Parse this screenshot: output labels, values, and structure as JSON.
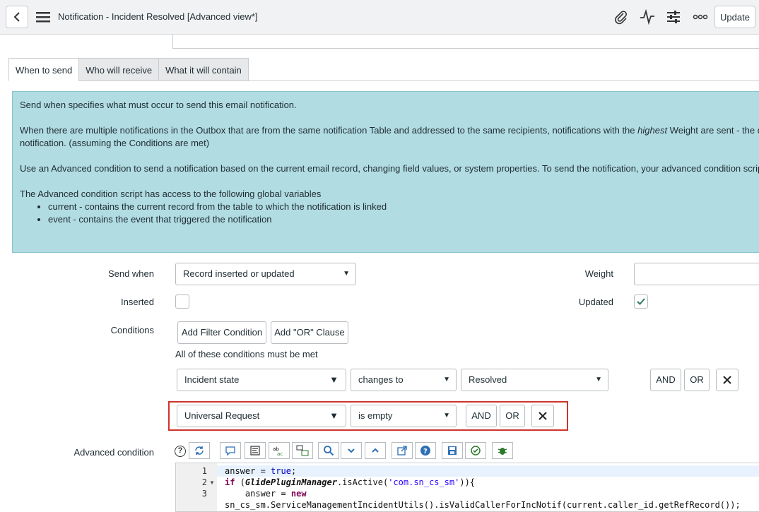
{
  "header": {
    "title": "Notification - Incident Resolved [Advanced view*]",
    "update_label": "Update"
  },
  "tabs": [
    {
      "label": "When to send",
      "active": true
    },
    {
      "label": "Who will receive",
      "active": false
    },
    {
      "label": "What it will contain",
      "active": false
    }
  ],
  "info": {
    "p1": "Send when specifies what must occur to send this email notification.",
    "p2a_pre": "When there are multiple notifications in the Outbox that are from the same notification Table and addressed to the same recipients, notifications with the ",
    "p2a_em": "highest",
    "p2a_post": " Weight are sent - the default value",
    "p2b": "notification. (assuming the Conditions are met)",
    "p3": "Use an Advanced condition to send a notification based on the current email record, changing field values, or system properties. To send the notification, your advanced condition script must set answer",
    "p4": "The Advanced condition script has access to the following global variables",
    "bullets": [
      "current - contains the current record from the table to which the notification is linked",
      "event - contains the event that triggered the notification"
    ]
  },
  "form": {
    "send_when_label": "Send when",
    "send_when_value": "Record inserted or updated",
    "weight_label": "Weight",
    "weight_value": "",
    "inserted_label": "Inserted",
    "inserted_checked": false,
    "updated_label": "Updated",
    "updated_checked": true,
    "conditions_label": "Conditions",
    "add_filter_label": "Add Filter Condition",
    "add_or_label": "Add \"OR\" Clause",
    "all_conditions_text": "All of these conditions must be met",
    "conditions": [
      {
        "field": "Incident state",
        "operator": "changes to",
        "value": "Resolved"
      },
      {
        "field": "Universal Request",
        "operator": "is empty"
      }
    ],
    "and_label": "AND",
    "or_label": "OR",
    "advanced_label": "Advanced condition"
  },
  "editor": {
    "help_glyph": "?",
    "line_numbers": [
      "1",
      "2",
      "3"
    ],
    "code": {
      "l1_a": "answer = ",
      "l1_b": "true",
      "l1_c": ";",
      "l2_a": "if",
      "l2_b": " (",
      "l2_c": "GlidePluginManager",
      "l2_d": ".isActive(",
      "l2_e": "'com.sn_cs_sm'",
      "l2_f": ")){",
      "l3_a": "    answer = ",
      "l3_b": "new",
      "l4": "sn_cs_sm.ServiceManagementIncidentUtils().isValidCallerForIncNotif(current.caller_id.getRefRecord());"
    }
  },
  "icons": {
    "back": "chevron-left-icon",
    "menu": "hamburger-menu-icon",
    "attachment": "paperclip-icon",
    "activity": "activity-pulse-icon",
    "settings": "sliders-icon",
    "more": "more-dots-icon",
    "remove": "close-icon"
  },
  "colors": {
    "info_bg": "#b1dce2",
    "highlight_border": "#d0342c",
    "check": "#2e7d5b"
  }
}
